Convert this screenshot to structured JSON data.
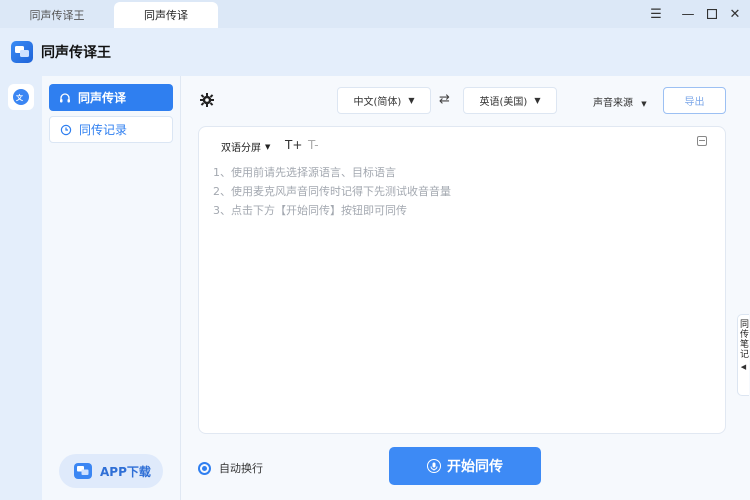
{
  "tabs": [
    {
      "label": "同声传译王"
    },
    {
      "label": "同声传译"
    }
  ],
  "window": {
    "menu_icon": "menu-icon",
    "minimize_icon": "minimize-icon",
    "maximize_icon": "maximize-icon",
    "close_icon": "close-icon"
  },
  "app": {
    "title": "同声传译王",
    "logo_icon": "app-logo-icon"
  },
  "nav": {
    "items": [
      {
        "label": "同声传译",
        "icon": "headphones-icon",
        "active": true
      },
      {
        "label": "同传记录",
        "icon": "clock-icon",
        "active": false
      }
    ],
    "app_download": "APP下载"
  },
  "toolbar": {
    "source_lang": "中文(简体)",
    "target_lang": "英语(美国)",
    "audio_source": "声音来源",
    "export": "导出"
  },
  "editor": {
    "mode": "双语分屏",
    "font_increase": "T+",
    "font_decrease": "T-",
    "hints": [
      "1、使用前请先选择源语言、目标语言",
      "2、使用麦克风声音同传时记得下先测试收音音量",
      "3、点击下方【开始同传】按钮即可同传"
    ]
  },
  "side_tab": {
    "label": "同传笔记"
  },
  "footer": {
    "auto_wrap": "自动换行",
    "start": "开始同传"
  },
  "colors": {
    "accent": "#2f7ff0",
    "start_button": "#3d8af5",
    "hint_text": "#a3a8b0"
  }
}
